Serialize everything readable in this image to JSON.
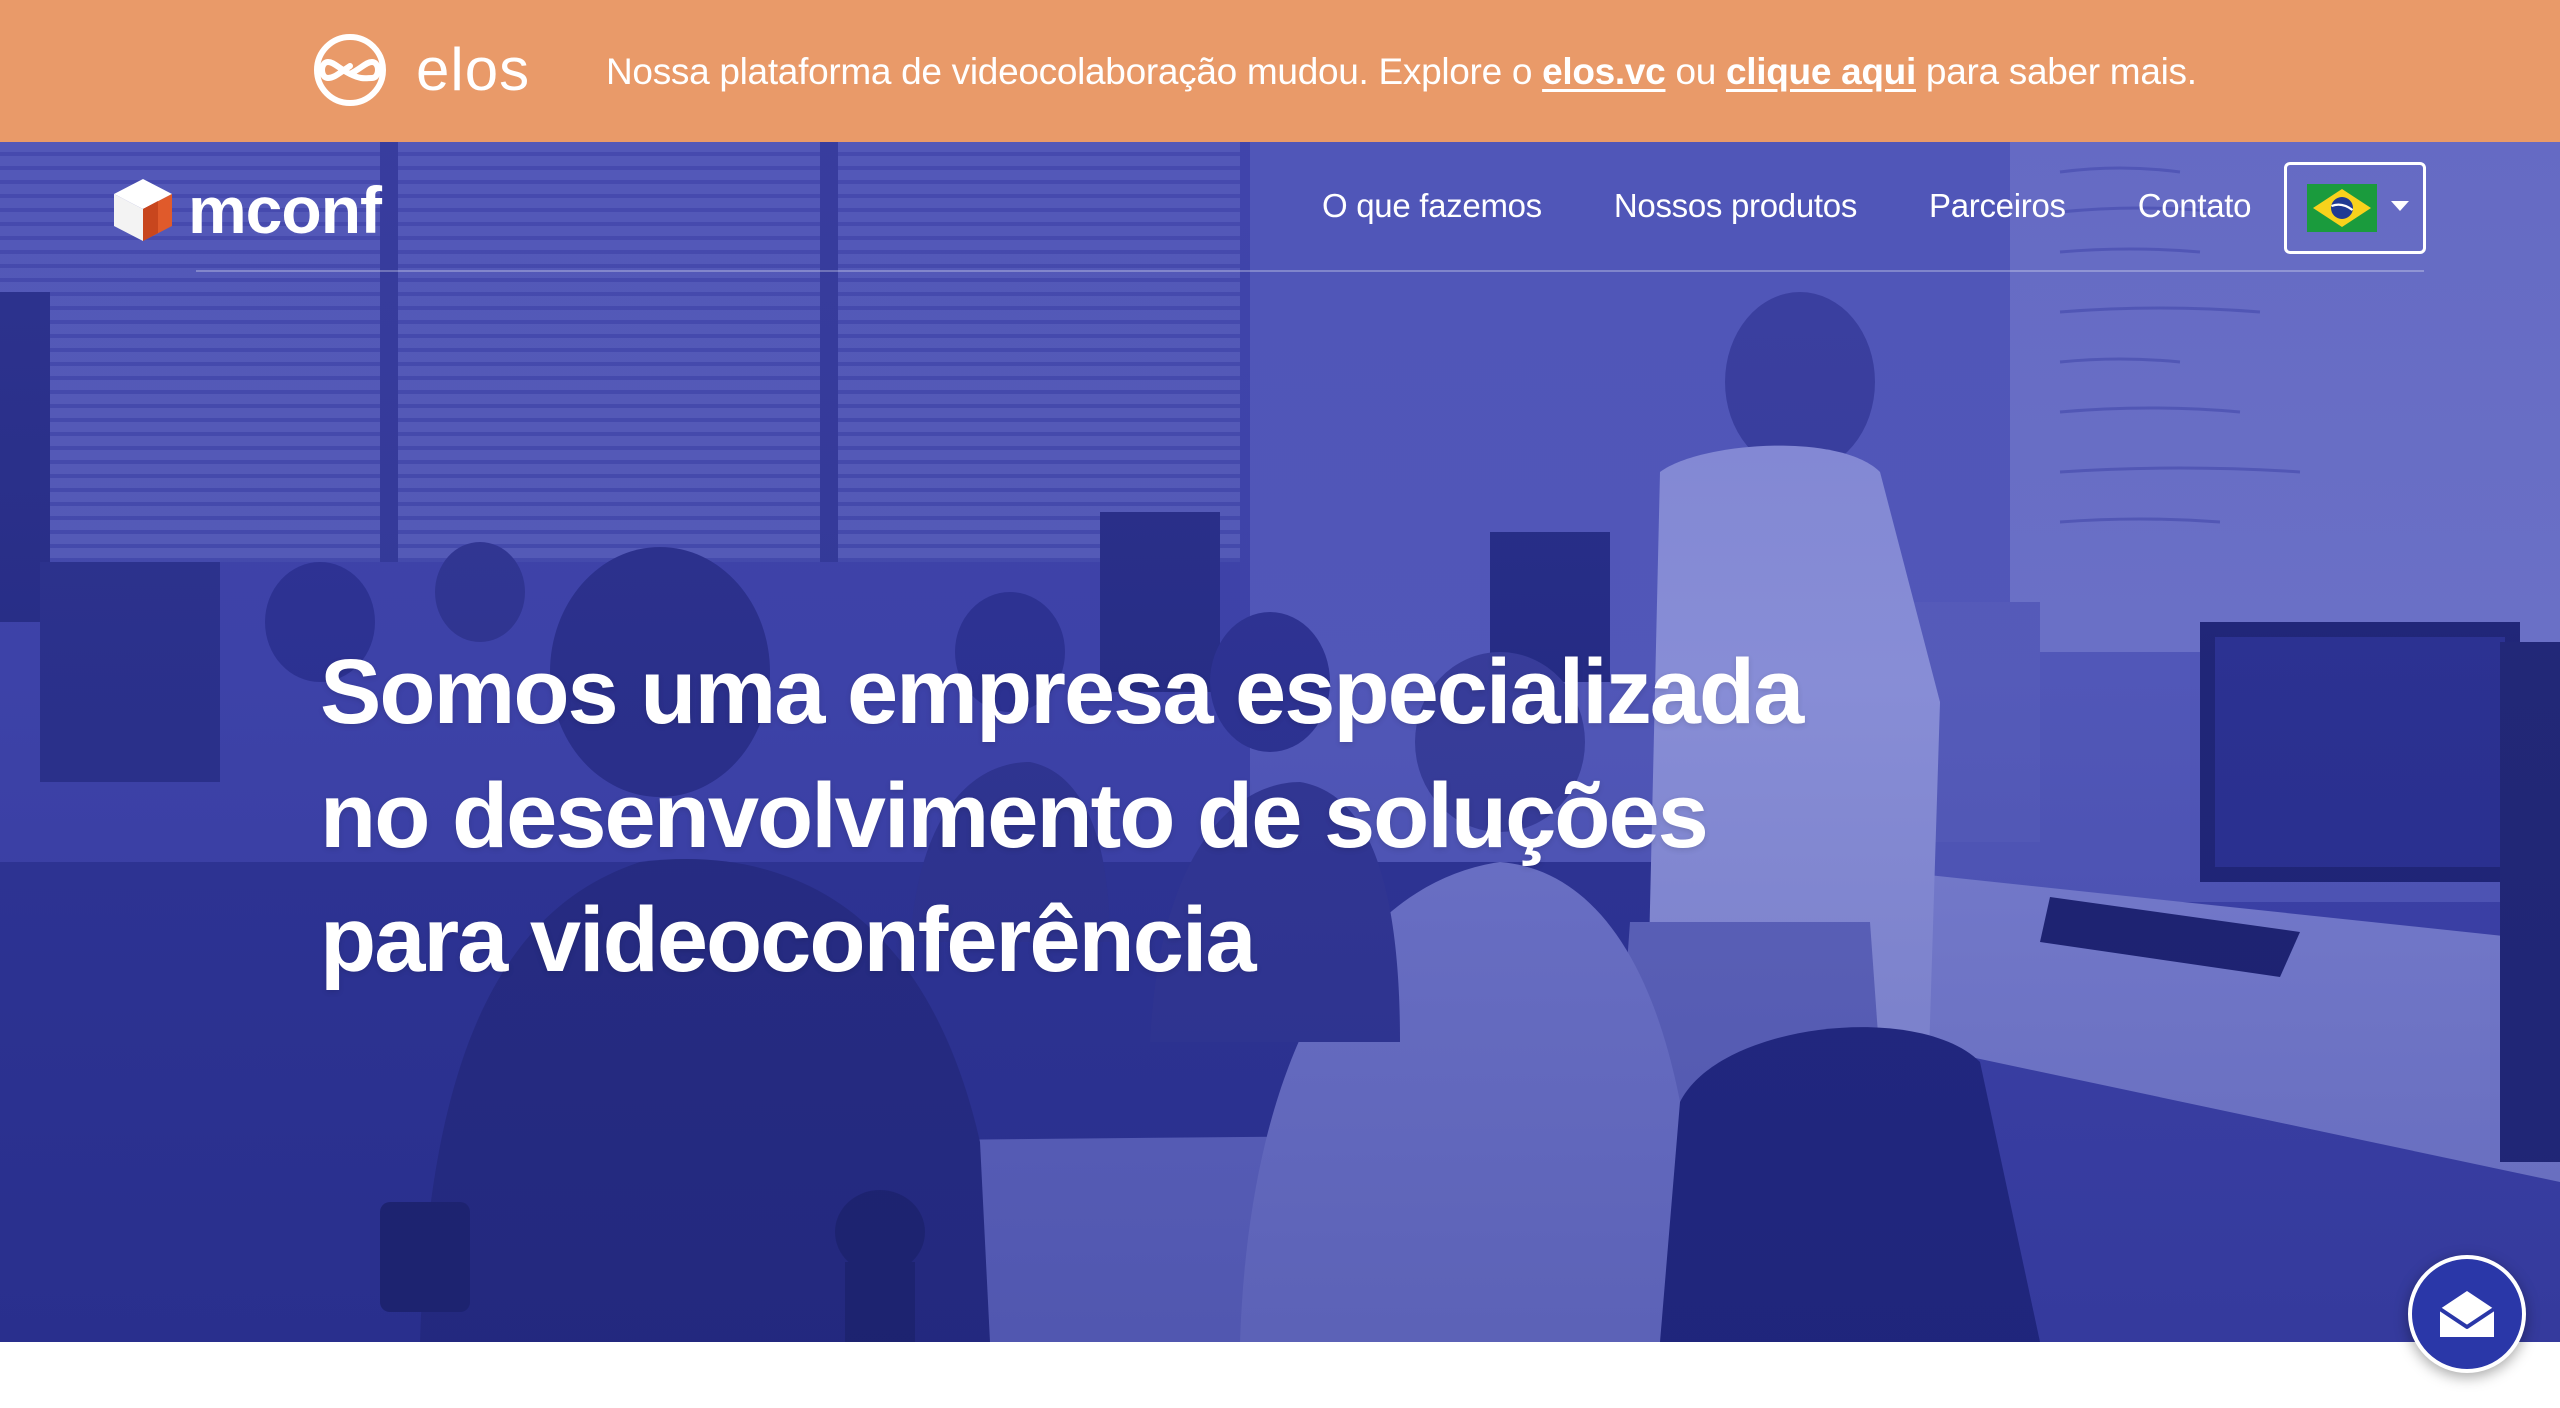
{
  "banner": {
    "brand_name": "elos",
    "message_before": "Nossa plataforma de videocolaboração mudou. Explore o ",
    "link_elos": "elos.vc",
    "message_middle": " ou ",
    "link_click": "clique aqui",
    "message_after": " para saber mais.",
    "background_color": "#e99a69"
  },
  "navbar": {
    "brand_name": "mconf",
    "brand_icon": "cube-logo-icon",
    "links": [
      "O que fazemos",
      "Nossos produtos",
      "Parceiros",
      "Contato"
    ],
    "language_flag": "brazil-flag-icon"
  },
  "hero": {
    "title_lines": [
      "Somos uma empresa especializada",
      "no desenvolvimento de soluções",
      "para videoconferência"
    ],
    "overlay_color": "#3b3fa6"
  },
  "contact_button": {
    "icon": "envelope-icon",
    "color": "#2a37a8"
  }
}
